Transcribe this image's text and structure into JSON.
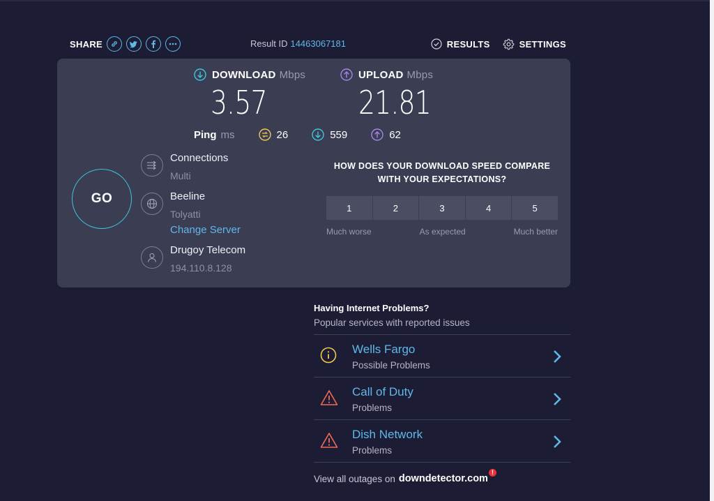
{
  "header": {
    "share_label": "SHARE",
    "share_icons": [
      "link-icon",
      "twitter-icon",
      "facebook-icon",
      "more-icon"
    ],
    "result_label": "Result ID",
    "result_id": "14463067181",
    "results_label": "RESULTS",
    "settings_label": "SETTINGS"
  },
  "metrics": {
    "download": {
      "label": "DOWNLOAD",
      "unit": "Mbps",
      "value": "3.57",
      "color": "#3ec6dc"
    },
    "upload": {
      "label": "UPLOAD",
      "unit": "Mbps",
      "value": "21.81",
      "color": "#a683e6"
    }
  },
  "ping": {
    "label": "Ping",
    "unit": "ms",
    "idle": "26",
    "download": "559",
    "upload": "62",
    "idle_color": "#f2c94c"
  },
  "go_label": "GO",
  "connections": {
    "title": "Connections",
    "value": "Multi"
  },
  "server": {
    "title": "Beeline",
    "location": "Tolyatti",
    "change_label": "Change Server"
  },
  "provider": {
    "title": "Drugoy Telecom",
    "ip": "194.110.8.128"
  },
  "survey": {
    "question_line1": "HOW DOES YOUR DOWNLOAD SPEED COMPARE",
    "question_line2": "WITH YOUR EXPECTATIONS?",
    "options": [
      "1",
      "2",
      "3",
      "4",
      "5"
    ],
    "label_low": "Much worse",
    "label_mid": "As expected",
    "label_high": "Much better"
  },
  "problems": {
    "title": "Having Internet Problems?",
    "subtitle": "Popular services with reported issues",
    "items": [
      {
        "name": "Wells Fargo",
        "status": "Possible Problems",
        "icon": "info-icon",
        "color": "#f2c94c"
      },
      {
        "name": "Call of Duty",
        "status": "Problems",
        "icon": "warning-icon",
        "color": "#f06a5b"
      },
      {
        "name": "Dish Network",
        "status": "Problems",
        "icon": "warning-icon",
        "color": "#f06a5b"
      }
    ],
    "footer_prefix": "View all outages on",
    "footer_brand": "downdetector.com",
    "footer_badge": "!"
  }
}
